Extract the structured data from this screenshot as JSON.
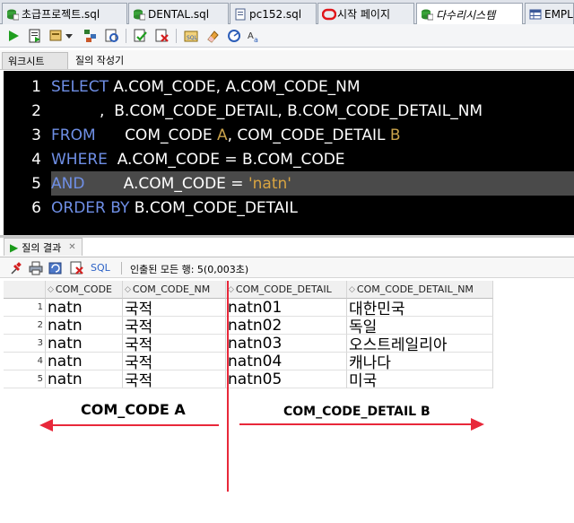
{
  "tabs": [
    {
      "label": "초급프로젝트.sql",
      "icon": "sql-db-icon",
      "active": false
    },
    {
      "label": "DENTAL.sql",
      "icon": "sql-db-icon",
      "active": false
    },
    {
      "label": "pc152.sql",
      "icon": "sql-file-icon",
      "active": false
    },
    {
      "label": "시작 페이지",
      "icon": "oracle-icon",
      "active": false
    },
    {
      "label": "다수리시스템",
      "icon": "sql-db-icon",
      "active": true
    },
    {
      "label": "EMPL",
      "icon": "table-icon",
      "active": false
    }
  ],
  "subtabs": {
    "worksheet": "워크시트",
    "query_builder": "질의 작성기"
  },
  "editor": {
    "line_numbers": [
      "1",
      "2",
      "3",
      "4",
      "5",
      "6"
    ],
    "lines": [
      {
        "kw": "SELECT",
        "text": " A.COM_CODE, A.COM_CODE_NM"
      },
      {
        "kw": "",
        "text": "          ,  B.COM_CODE_DETAIL, B.COM_CODE_DETAIL_NM"
      },
      {
        "kw": "FROM",
        "text": "      COM_CODE ",
        "alias": "A",
        "text2": ", COM_CODE_DETAIL ",
        "alias2": "B"
      },
      {
        "kw": "WHERE",
        "text": "  A.COM_CODE = B.COM_CODE"
      },
      {
        "kw": "AND",
        "text": "        A.COM_CODE = ",
        "str": "'natn'"
      },
      {
        "kw": "ORDER BY",
        "text": " B.COM_CODE_DETAIL"
      }
    ]
  },
  "results": {
    "tab_label": "질의 결과",
    "sql_link": "SQL",
    "status": "인출된 모든 행: 5(0,003초)",
    "columns": [
      "COM_CODE",
      "COM_CODE_NM",
      "COM_CODE_DETAIL",
      "COM_CODE_DETAIL_NM"
    ],
    "rows": [
      {
        "num": "1",
        "cells": [
          "natn",
          "국적",
          "natn01",
          "대한민국"
        ]
      },
      {
        "num": "2",
        "cells": [
          "natn",
          "국적",
          "natn02",
          "독일"
        ]
      },
      {
        "num": "3",
        "cells": [
          "natn",
          "국적",
          "natn03",
          "오스트레일리아"
        ]
      },
      {
        "num": "4",
        "cells": [
          "natn",
          "국적",
          "natn04",
          "캐나다"
        ]
      },
      {
        "num": "5",
        "cells": [
          "natn",
          "국적",
          "natn05",
          "미국"
        ]
      }
    ]
  },
  "annotations": {
    "left_label": "COM_CODE A",
    "right_label": "COM_CODE_DETAIL B",
    "color": "#e8283a"
  },
  "colors": {
    "keyword": "#6f8fe6",
    "string": "#d9a441",
    "editor_bg": "#000000"
  }
}
